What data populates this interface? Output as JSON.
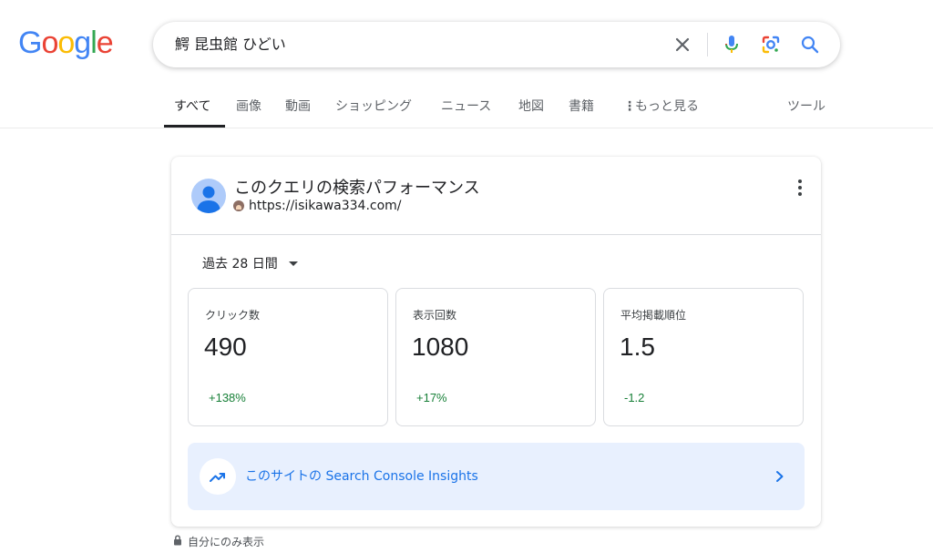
{
  "colors": {
    "google_blue": "#4285F4",
    "google_red": "#EA4335",
    "google_yellow": "#FBBC05",
    "google_green": "#34A853",
    "link_blue": "#1a73e8",
    "positive_green": "#188038",
    "insights_bg": "#e8f0fe"
  },
  "logo": {
    "letters": [
      "G",
      "o",
      "o",
      "g",
      "l",
      "e"
    ]
  },
  "search": {
    "query": "鰐 昆虫館 ひどい",
    "icons": [
      "close-icon",
      "mic-icon",
      "lens-icon",
      "search-icon"
    ]
  },
  "tabs": [
    {
      "label": "すべて",
      "active": true
    },
    {
      "label": "画像"
    },
    {
      "label": "動画"
    },
    {
      "label": "ショッピング"
    },
    {
      "label": "ニュース"
    },
    {
      "label": "地図"
    },
    {
      "label": "書籍"
    },
    {
      "label": "もっと見る"
    },
    {
      "label": "ツール"
    }
  ],
  "card": {
    "title": "このクエリの検索パフォーマンス",
    "site_url": "https://isikawa334.com/",
    "period_label": "過去 28 日間",
    "metrics": [
      {
        "label": "クリック数",
        "value": "490",
        "change": "+138%"
      },
      {
        "label": "表示回数",
        "value": "1080",
        "change": "+17%"
      },
      {
        "label": "平均掲載順位",
        "value": "1.5",
        "change": "-1.2"
      }
    ],
    "insights_link": "このサイトの Search Console Insights"
  },
  "footer": {
    "private_note": "自分にのみ表示"
  }
}
